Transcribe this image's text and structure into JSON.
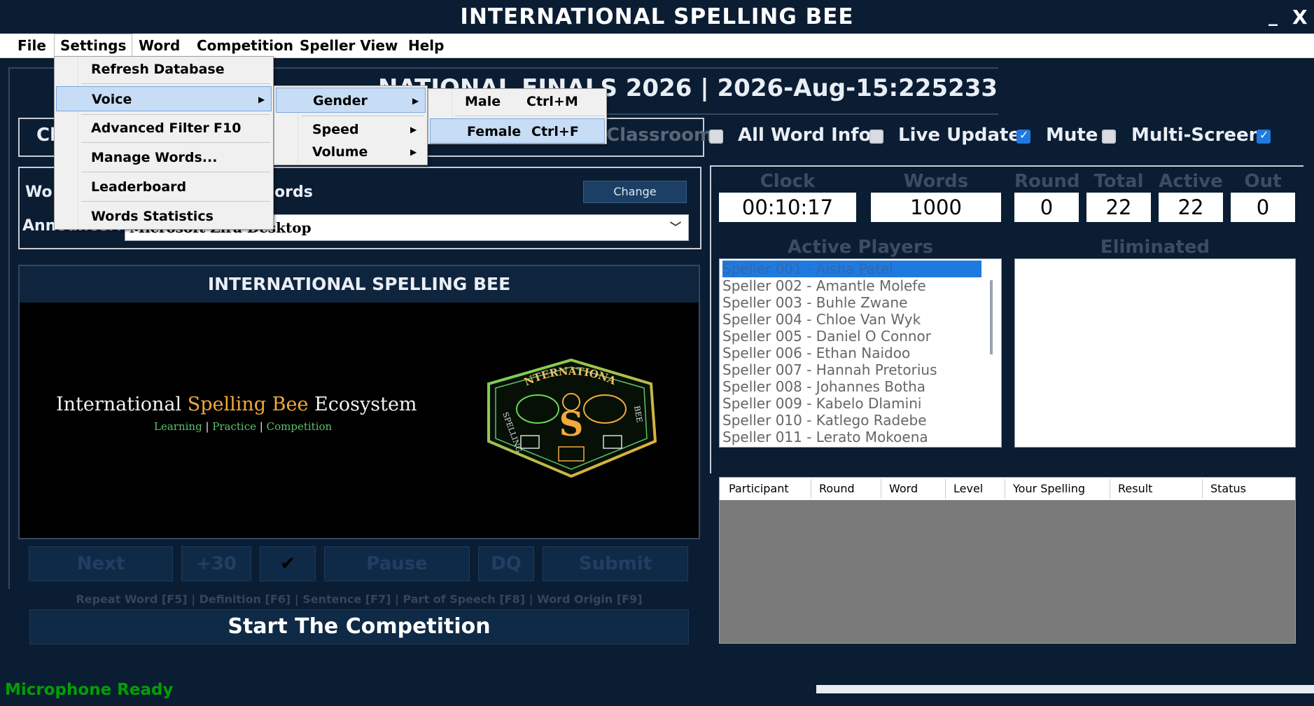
{
  "window": {
    "title": "INTERNATIONAL SPELLING BEE",
    "minimize": "_",
    "close": "X"
  },
  "menubar": [
    "File",
    "Settings",
    "Word",
    "Competition",
    "Speller View",
    "Help"
  ],
  "settings_menu": {
    "items": [
      "Refresh Database",
      "Voice",
      "Advanced Filter",
      "Manage Words...",
      "Leaderboard",
      "Words Statistics"
    ],
    "advanced_filter_shortcut": "F10"
  },
  "voice_menu": [
    "Gender",
    "Speed",
    "Volume"
  ],
  "gender_menu": [
    {
      "label": "Male",
      "shortcut": "Ctrl+M"
    },
    {
      "label": "Female",
      "shortcut": "Ctrl+F"
    }
  ],
  "banner": "NATIONAL FINALS 2026 | 2026-Aug-15:225233",
  "options": {
    "classroom_prefix": "Cl",
    "classroom_label": "Classroom",
    "all_word_info": "All Word Info",
    "live_update": "Live Update",
    "mute": "Mute",
    "multi_screen": "Multi-Screen"
  },
  "words_section": {
    "label_prefix": "Wo",
    "label_suffix": "ords",
    "change_button": "Change",
    "announcer_label": "Announcer:",
    "voice_value": "Microsoft Zira Desktop"
  },
  "logo_panel": {
    "header": "INTERNATIONAL SPELLING BEE",
    "tagline_a": "International ",
    "tagline_b": "Spelling Bee",
    "tagline_c": " Ecosystem",
    "sub_1": "Learning",
    "sub_2": "Practice",
    "sub_3": "Competition",
    "sub_sep": "|",
    "emblem_top": "INTERNATIONAL",
    "emblem_left": "SPELLING",
    "emblem_right": "BEE",
    "emblem_center": "S"
  },
  "controls": [
    "Next",
    "+30",
    "✔",
    "Pause",
    "DQ",
    "Submit"
  ],
  "hotkeys": "Repeat Word [F5] | Definition [F6] | Sentence [F7] | Part of Speech [F8] | Word Origin [F9]",
  "start_button": "Start The Competition",
  "status": "Microphone Ready",
  "stats": {
    "labels": [
      "Clock",
      "Words",
      "Round",
      "Total",
      "Active",
      "Out"
    ],
    "values": [
      "00:10:17",
      "1000",
      "0",
      "22",
      "22",
      "0"
    ]
  },
  "active_players_label": "Active Players",
  "eliminated_label": "Eliminated",
  "players": [
    "Speller 001 -  Aisha Patel",
    "Speller 002 -  Amantle Molefe",
    "Speller 003 -  Buhle Zwane",
    "Speller 004 -  Chloe Van Wyk",
    "Speller 005 -  Daniel O Connor",
    "Speller 006 -  Ethan Naidoo",
    "Speller 007 -  Hannah Pretorius",
    "Speller 008 -  Johannes Botha",
    "Speller 009 -  Kabelo Dlamini",
    "Speller 010 -  Katlego Radebe",
    "Speller 011 -  Lerato Mokoena"
  ],
  "results_columns": [
    "Participant",
    "Round",
    "Word",
    "Level",
    "Your Spelling",
    "Result",
    "Status"
  ],
  "colors": {
    "background": "#0b1d33",
    "accent": "#1f7ae0",
    "status_green": "#00a000",
    "highlight_gold": "#f2a93b"
  }
}
